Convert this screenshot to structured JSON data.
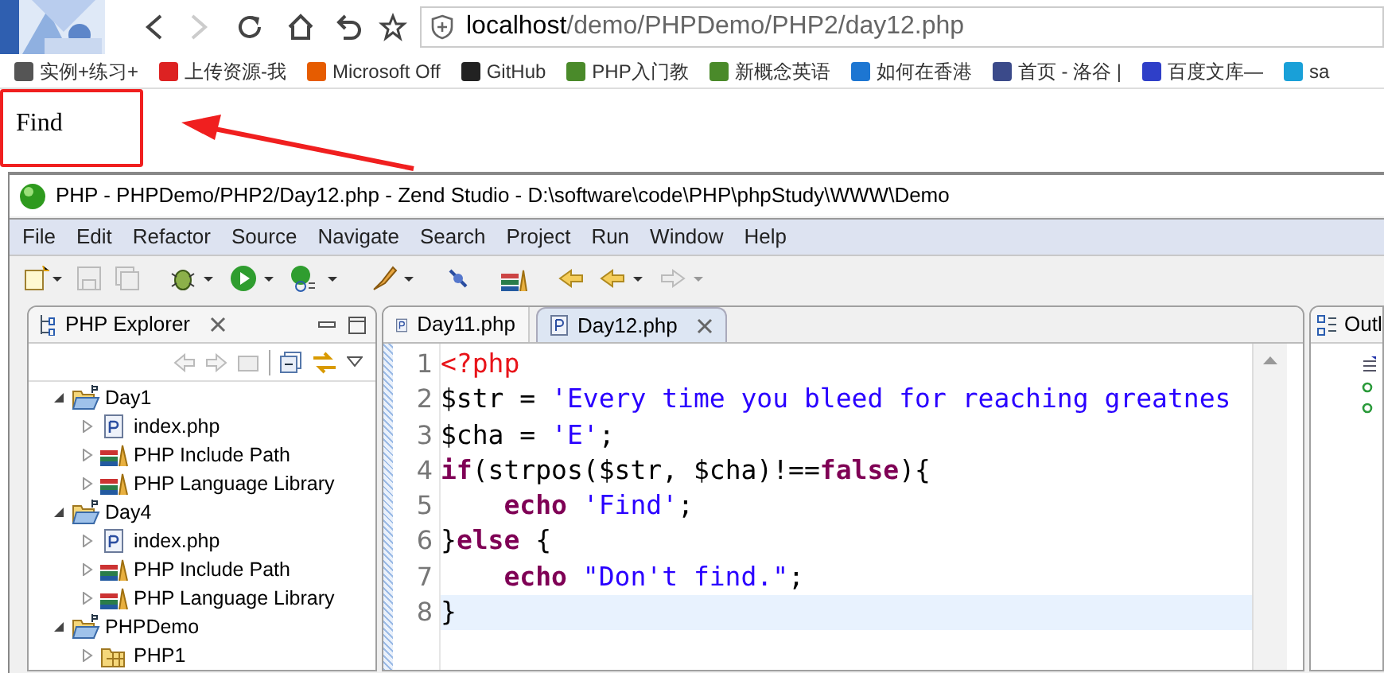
{
  "browser": {
    "forward_disabled": true,
    "url": {
      "host": "localhost",
      "path": "/demo/PHPDemo/PHP2/day12.php"
    },
    "bookmarks": [
      "实例+练习+",
      "上传资源-我",
      "Microsoft Off",
      "GitHub",
      "PHP入门教",
      "新概念英语",
      "如何在香港",
      "首页 - 洛谷 |",
      "百度文库—",
      "sa"
    ]
  },
  "page": {
    "output": "Find"
  },
  "ide": {
    "title": "PHP - PHPDemo/PHP2/Day12.php - Zend Studio - D:\\software\\code\\PHP\\phpStudy\\WWW\\Demo",
    "menu": [
      "File",
      "Edit",
      "Refactor",
      "Source",
      "Navigate",
      "Search",
      "Project",
      "Run",
      "Window",
      "Help"
    ],
    "explorer": {
      "title": "PHP Explorer",
      "tree": [
        {
          "label": "Day1",
          "kind": "project",
          "expanded": true,
          "children": [
            {
              "label": "index.php",
              "kind": "file",
              "expanded": false
            },
            {
              "label": "PHP Include Path",
              "kind": "library",
              "expanded": false
            },
            {
              "label": "PHP Language Library",
              "kind": "library",
              "expanded": false
            }
          ]
        },
        {
          "label": "Day4",
          "kind": "project",
          "expanded": true,
          "children": [
            {
              "label": "index.php",
              "kind": "file",
              "expanded": false
            },
            {
              "label": "PHP Include Path",
              "kind": "library",
              "expanded": false
            },
            {
              "label": "PHP Language Library",
              "kind": "library",
              "expanded": false
            }
          ]
        },
        {
          "label": "PHPDemo",
          "kind": "project",
          "expanded": true,
          "children": [
            {
              "label": "PHP1",
              "kind": "folder",
              "expanded": false
            }
          ]
        }
      ]
    },
    "editor": {
      "tabs": [
        {
          "label": "Day11.php",
          "selected": false
        },
        {
          "label": "Day12.php",
          "selected": true
        }
      ],
      "lines": [
        {
          "number": "1",
          "current": false,
          "tokens": [
            {
              "kind": "tag",
              "text": "<?php"
            }
          ]
        },
        {
          "number": "2",
          "current": false,
          "tokens": [
            {
              "kind": "plain",
              "text": "$str = "
            },
            {
              "kind": "string",
              "text": "'Every time you bleed for reaching greatnes"
            }
          ]
        },
        {
          "number": "3",
          "current": false,
          "tokens": [
            {
              "kind": "plain",
              "text": "$cha = "
            },
            {
              "kind": "string",
              "text": "'E'"
            },
            {
              "kind": "plain",
              "text": ";"
            }
          ]
        },
        {
          "number": "4",
          "current": false,
          "tokens": [
            {
              "kind": "keyword",
              "text": "if"
            },
            {
              "kind": "plain",
              "text": "(strpos($str, $cha)!=="
            },
            {
              "kind": "keyword",
              "text": "false"
            },
            {
              "kind": "plain",
              "text": "){"
            }
          ]
        },
        {
          "number": "5",
          "current": false,
          "indented": true,
          "tokens": [
            {
              "kind": "keyword",
              "text": "echo",
              "space_after": true
            },
            {
              "kind": "string",
              "text": "'Find'"
            },
            {
              "kind": "plain",
              "text": ";"
            }
          ]
        },
        {
          "number": "6",
          "current": false,
          "tokens": [
            {
              "kind": "plain",
              "text": "}"
            },
            {
              "kind": "keyword",
              "text": "else"
            },
            {
              "kind": "plain",
              "text": " {"
            }
          ]
        },
        {
          "number": "7",
          "current": false,
          "indented": true,
          "tokens": [
            {
              "kind": "keyword",
              "text": "echo",
              "space_after": true
            },
            {
              "kind": "string",
              "text": "\"Don't find.\""
            },
            {
              "kind": "plain",
              "text": ";"
            }
          ]
        },
        {
          "number": "8",
          "current": true,
          "tokens": [
            {
              "kind": "plain",
              "text": "}"
            }
          ]
        }
      ]
    },
    "outline": {
      "title": "Outl"
    }
  }
}
